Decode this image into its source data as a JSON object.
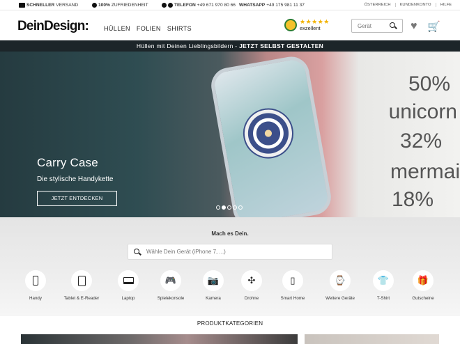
{
  "topbar": {
    "shipping_bold": "SCHNELLER",
    "shipping": "VERSAND",
    "satisfaction_bold": "100%",
    "satisfaction": "ZUFRIEDENHEIT",
    "phone_bold": "TELEFON",
    "phone": "+49 671 970 80 66",
    "whatsapp_bold": "WHATSAPP",
    "whatsapp": "+49 175 981 11 37",
    "links": [
      "ÖSTERREICH",
      "KUNDENKONTO",
      "HILFE"
    ]
  },
  "header": {
    "logo": "DeinDesign:",
    "nav": [
      "HÜLLEN",
      "FOLIEN",
      "SHIRTS"
    ],
    "rating_stars": "★★★★★",
    "rating_text": "exzellent",
    "search_placeholder": "Gerät"
  },
  "promo": {
    "text": "Hüllen mit Deinen Lieblingsbildern - ",
    "cta": "JETZT SELBST GESTALTEN"
  },
  "hero": {
    "title": "Carry Case",
    "subtitle": "Die stylische Handykette",
    "button": "JETZT ENTDECKEN",
    "shirt_lines": [
      "50%",
      "unicorn",
      "32%",
      "mermai",
      "18%"
    ],
    "slides": 5,
    "active_slide": 1
  },
  "device_section": {
    "heading": "Mach es Dein.",
    "search_placeholder": "Wähle Dein Gerät (iPhone 7, ...)",
    "devices": [
      {
        "label": "Handy",
        "icon": "phone-icon"
      },
      {
        "label": "Tablet & E-Reader",
        "icon": "tablet-icon"
      },
      {
        "label": "Laptop",
        "icon": "laptop-icon"
      },
      {
        "label": "Spielekonsole",
        "icon": "gamepad-icon"
      },
      {
        "label": "Kamera",
        "icon": "camera-icon"
      },
      {
        "label": "Drohne",
        "icon": "drone-icon"
      },
      {
        "label": "Smart Home",
        "icon": "smart-speaker-icon"
      },
      {
        "label": "Weitere Geräte",
        "icon": "watch-icon"
      },
      {
        "label": "T-Shirt",
        "icon": "tshirt-icon"
      },
      {
        "label": "Gutscheine",
        "icon": "voucher-icon"
      }
    ]
  },
  "categories": {
    "title": "PRODUKTKATEGORIEN"
  }
}
